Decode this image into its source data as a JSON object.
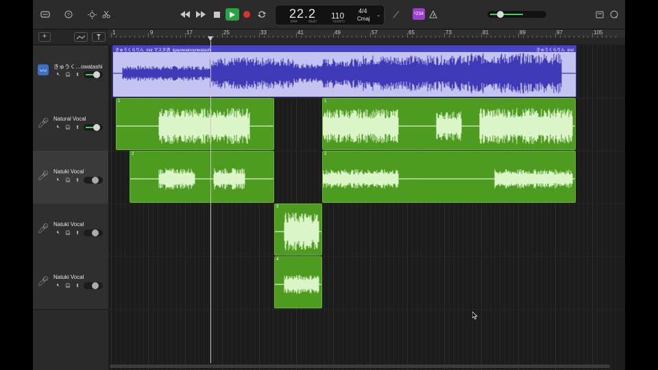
{
  "transport": {
    "rewind_icon": "rewind-icon",
    "forward_icon": "forward-icon",
    "stop_icon": "stop-icon",
    "play_icon": "play-icon",
    "record_icon": "record-icon",
    "cycle_icon": "cycle-icon"
  },
  "lcd": {
    "position": "22.2",
    "bar_label": "BAR",
    "beat_label": "BEAT",
    "tempo": "110",
    "tempo_label": "TEMPO",
    "time_signature": "4/4",
    "key": "Cmaj"
  },
  "count_in": "¹234",
  "add_track_label": "+",
  "ruler": {
    "bars": [
      "1",
      "9",
      "17",
      "25",
      "33",
      "41",
      "49",
      "57",
      "65",
      "73",
      "81",
      "89",
      "97",
      "105"
    ]
  },
  "tracks": [
    {
      "name": "きゅうく…owatashi",
      "type": "audio"
    },
    {
      "name": "Natural Vocal",
      "type": "mic"
    },
    {
      "name": "Natuki Vocal",
      "type": "mic"
    },
    {
      "name": "Natuki Vocal",
      "type": "mic"
    },
    {
      "name": "Natuki Vocal",
      "type": "mic"
    }
  ],
  "regions": {
    "inst_title_left": "きゅうくらりん_inst マスタ済_igayowainoyowatashi",
    "inst_title_right": "きゅうくらりん_inst",
    "r1a": "1",
    "r1b": "1",
    "r2a": "2",
    "r2b": "2",
    "r3": "3",
    "r4": "4"
  },
  "colors": {
    "accent_green": "#4d9c1f",
    "audio_blue": "#4440c4",
    "record_red": "#e0302b",
    "play_green": "#26a641",
    "count_in_purple": "#9f3fd0"
  }
}
